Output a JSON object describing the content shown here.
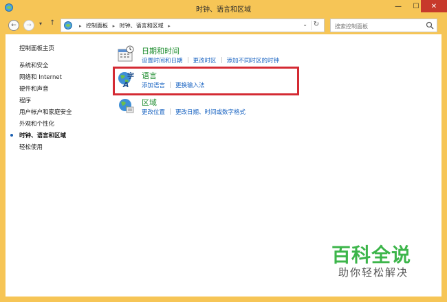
{
  "window": {
    "title": "时钟、语言和区域"
  },
  "address": {
    "crumbs": [
      "控制面板",
      "时钟、语言和区域"
    ],
    "search_placeholder": "搜索控制面板"
  },
  "sidebar": {
    "items": [
      {
        "label": "控制面板主页",
        "current": false
      },
      {
        "label": "系统和安全",
        "current": false
      },
      {
        "label": "网络和 Internet",
        "current": false
      },
      {
        "label": "硬件和声音",
        "current": false
      },
      {
        "label": "程序",
        "current": false
      },
      {
        "label": "用户帐户和家庭安全",
        "current": false
      },
      {
        "label": "外观和个性化",
        "current": false
      },
      {
        "label": "时钟、语言和区域",
        "current": true
      },
      {
        "label": "轻松使用",
        "current": false
      }
    ]
  },
  "categories": [
    {
      "heading": "日期和时间",
      "icon": "calendar-clock-icon",
      "links": [
        "设置时间和日期",
        "更改时区",
        "添加不同时区的时钟"
      ]
    },
    {
      "heading": "语言",
      "icon": "language-globe-icon",
      "links": [
        "添加语言",
        "更换输入法"
      ]
    },
    {
      "heading": "区域",
      "icon": "region-globe-icon",
      "links": [
        "更改位置",
        "更改日期、时间或数字格式"
      ]
    }
  ],
  "watermark": {
    "logo": "百科全说",
    "tagline": "助你轻松解决"
  },
  "colors": {
    "titlebar": "#f6c556",
    "heading_green": "#1d8c2e",
    "link_blue": "#1a64c2",
    "highlight_red": "#d42a33",
    "watermark_green": "#3cb54a"
  }
}
